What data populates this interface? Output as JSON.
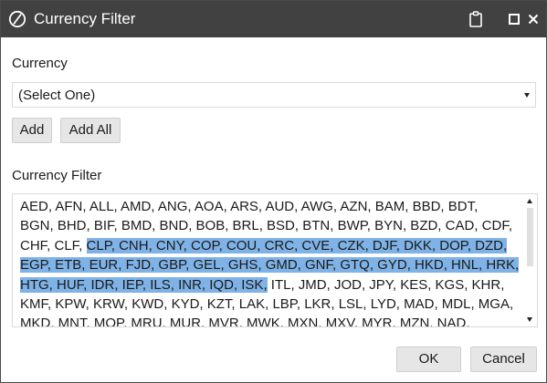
{
  "window": {
    "title": "Currency Filter",
    "controls": [
      "clipboard-icon",
      "maximize-icon",
      "close-icon"
    ]
  },
  "currency": {
    "label": "Currency",
    "select_value": "(Select One)"
  },
  "buttons": {
    "add": "Add",
    "add_all": "Add All",
    "ok": "OK",
    "cancel": "Cancel"
  },
  "filter": {
    "label": "Currency Filter",
    "lines": [
      {
        "pre": "AED, AFN, ALL, AMD, ANG, AOA, ARS, AUD, AWG, AZN, BAM, BBD, BDT,",
        "sel": "",
        "post": ""
      },
      {
        "pre": "BGN, BHD, BIF, BMD, BND, BOB, BRL, BSD, BTN, BWP, BYN, BZD, CAD, CDF,",
        "sel": "",
        "post": ""
      },
      {
        "pre": "CHF, CLF, ",
        "sel": "CLP, CNH, CNY, COP, COU, CRC, CVE, CZK, DJF, DKK, DOP, DZD,",
        "post": ""
      },
      {
        "pre": "",
        "sel": "EGP, ETB, EUR, FJD, GBP, GEL, GHS, GMD, GNF, GTQ, GYD, HKD, HNL, HRK,",
        "post": ""
      },
      {
        "pre": "",
        "sel": "HTG, HUF, IDR, IEP, ILS, INR, IQD, ISK,",
        "post": " ITL, JMD, JOD, JPY, KES, KGS, KHR,"
      },
      {
        "pre": "KMF, KPW, KRW, KWD, KYD, KZT, LAK, LBP, LKR, LSL, LYD, MAD, MDL, MGA,",
        "sel": "",
        "post": ""
      },
      {
        "pre": "MKD, MNT, MOP, MRU, MUR, MVR, MWK, MXN, MXV, MYR, MZN, NAD,",
        "sel": "",
        "post": ""
      }
    ]
  },
  "colors": {
    "titlebar": "#414141",
    "selection": "#7fb2e6",
    "button_bg": "#e6e6e6"
  }
}
